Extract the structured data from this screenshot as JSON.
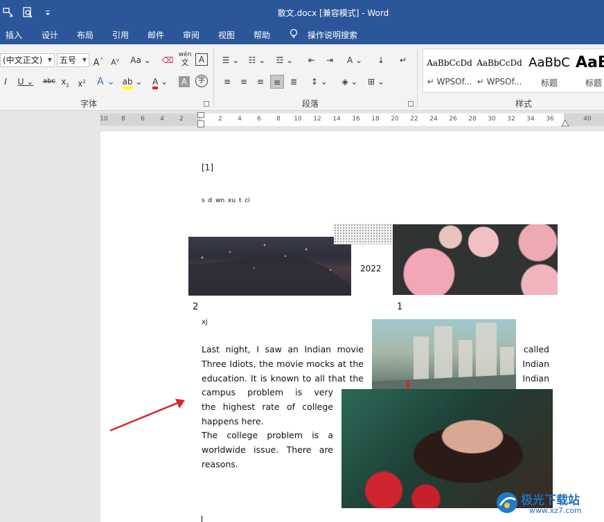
{
  "titlebar": {
    "title": "散文.docx [兼容模式]  -  Word",
    "quick_access": [
      "touch-mode-icon",
      "print-preview-icon",
      "customize-qa-icon"
    ]
  },
  "menu": {
    "tabs": [
      "插入",
      "设计",
      "布局",
      "引用",
      "邮件",
      "审阅",
      "视图",
      "帮助"
    ],
    "tell_me": "操作说明搜索"
  },
  "ribbon": {
    "font_name": "(中文正文)",
    "font_size": "五号",
    "change_case": "Aa",
    "wen_label": "wén",
    "wen_char": "文",
    "char_border": "A",
    "groups": {
      "font": "字体",
      "paragraph": "段落",
      "styles": "样式"
    },
    "styles": [
      {
        "sample": "AaBbCcDd",
        "name": "WPSOf..."
      },
      {
        "sample": "AaBbCcDd",
        "name": "WPSOf..."
      },
      {
        "sample": "AaBbC",
        "name": "标题"
      },
      {
        "sample": "AaB",
        "name": "标题"
      }
    ],
    "colors": {
      "highlight": "#ffff00",
      "font_color": "#e02020",
      "accent": "#2b579a"
    }
  },
  "ruler": {
    "labels": [
      "10",
      "8",
      "6",
      "4",
      "2",
      "2",
      "4",
      "6",
      "8",
      "10",
      "12",
      "14",
      "16",
      "18",
      "20",
      "22",
      "24",
      "26",
      "28",
      "30",
      "32",
      "34",
      "36",
      "40"
    ]
  },
  "document": {
    "footnote_ref": "[1]",
    "small_line": "s  d  wn  xu  t  ci",
    "year": "2022",
    "caption_left": "2",
    "caption_right": "1",
    "xj": "xj",
    "para1_lines": [
      [
        "Last night, I saw an Indian movie which is",
        "called"
      ],
      [
        "Three Idiots, the movie mocks at the",
        "Indian"
      ],
      [
        "education. It is known to all that the",
        "Indian"
      ]
    ],
    "para1_cont": [
      "campus problem is very serious,",
      "the highest rate of college",
      "happens here."
    ],
    "para2": [
      "The college problem is a",
      "worldwide issue. There are many",
      "reasons."
    ]
  },
  "watermark": {
    "brand": "极光下载站",
    "url": "www.xz7.com"
  }
}
